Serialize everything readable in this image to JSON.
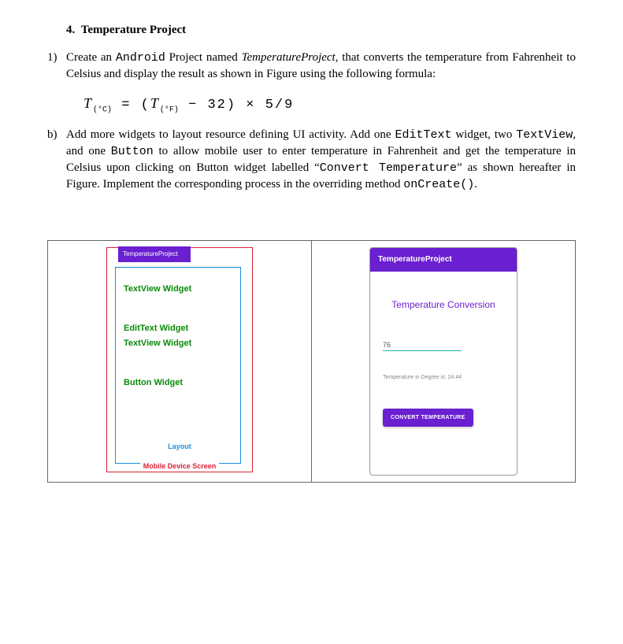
{
  "section": {
    "number": "4.",
    "title": "Temperature Project"
  },
  "q1": {
    "num": "1)",
    "text_pre": "Create an ",
    "code1": "Android",
    "text_mid": " Project named ",
    "ital": "TemperatureProject",
    "text_post": ", that converts the temperature from Fahrenheit to Celsius and display the result as shown in Figure using the following formula:"
  },
  "formula": {
    "var1": "T",
    "sub1": "(°C)",
    "eq": " = (",
    "var2": "T",
    "sub2": "(°F)",
    "rest": " − 32) × 5/9"
  },
  "qb": {
    "num": "b)",
    "p1": "Add more widgets to layout resource defining UI activity. Add one ",
    "c1": "EditText",
    "p2": " widget, two ",
    "c2": "TextView",
    "p3": ", and one ",
    "c3": "Button",
    "p4": " to allow mobile user to enter temperature in Fahrenheit and get the temperature in Celsius upon clicking on Button widget labelled “",
    "c4": "Convert Temperature",
    "p5": "” as shown hereafter in Figure. Implement the corresponding process in the overriding method ",
    "c5": "onCreate()",
    "p6": "."
  },
  "mock": {
    "toolbar": "TemperatureProject",
    "tv1": "TextView Widget",
    "et": "EditText Widget",
    "tv2": "TextView Widget",
    "btn": "Button Widget",
    "layout_lbl": "Layout",
    "device_lbl": "Mobile Device Screen"
  },
  "phone": {
    "appbar": "TemperatureProject",
    "title": "Temperature Conversion",
    "input_value": "76",
    "result": "Temperature in Degree is: 24.44",
    "button": "CONVERT TEMPERATURE"
  }
}
